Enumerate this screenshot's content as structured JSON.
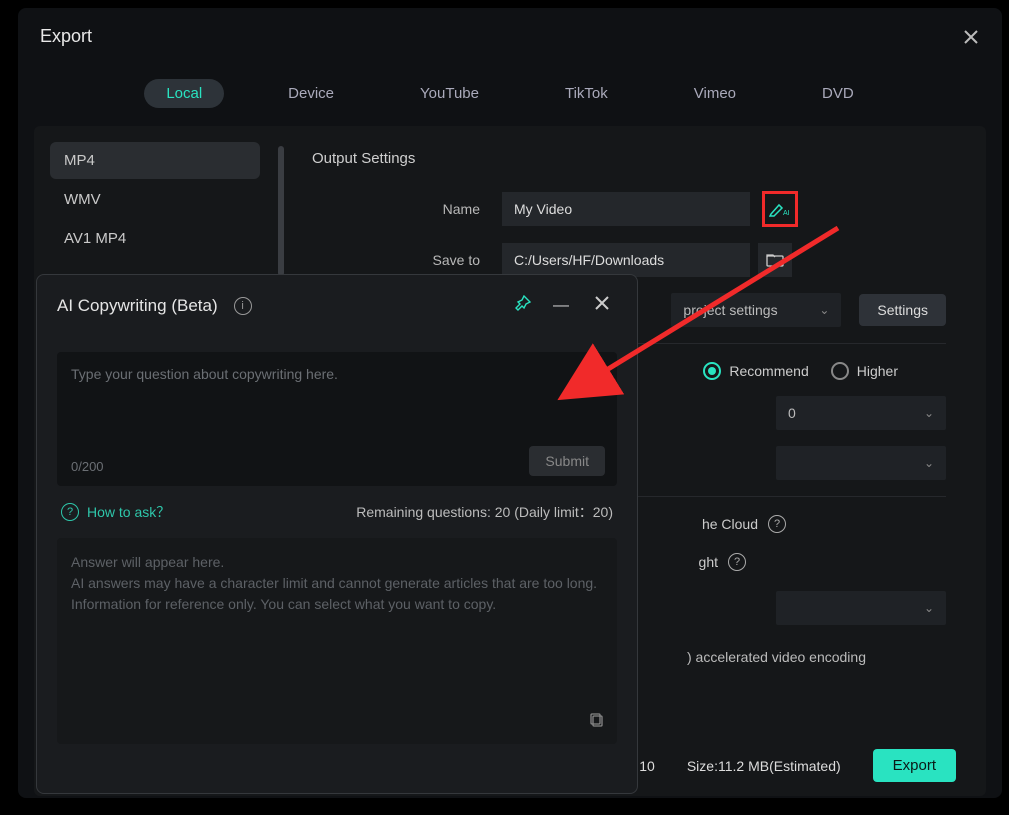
{
  "modal": {
    "title": "Export"
  },
  "tabs": [
    "Local",
    "Device",
    "YouTube",
    "TikTok",
    "Vimeo",
    "DVD"
  ],
  "active_tab": "Local",
  "formats": [
    "MP4",
    "WMV",
    "AV1 MP4"
  ],
  "active_format": "MP4",
  "settings": {
    "section_title": "Output Settings",
    "name_label": "Name",
    "name_value": "My Video",
    "saveto_label": "Save to",
    "saveto_value": "C:/Users/HF/Downloads",
    "preset_partial": "project settings",
    "settings_btn": "Settings",
    "quality": {
      "recommend": "Recommend",
      "higher": "Higher"
    },
    "dropdown_val": "0",
    "cloud_partial": "he Cloud",
    "spot_partial": "ght",
    "gpu_partial": ") accelerated video encoding"
  },
  "footer": {
    "val10": "10",
    "size": "Size:11.2 MB(Estimated)",
    "export_btn": "Export"
  },
  "ai": {
    "title": "AI Copywriting (Beta)",
    "placeholder": "Type your question about copywriting here.",
    "char_count": "0/200",
    "submit": "Submit",
    "how_to_ask": "How to ask？",
    "remaining": "Remaining questions: 20 (Daily limit：20)",
    "answer_line1": "Answer will appear here.",
    "answer_line2": "AI answers may have a character limit and cannot generate articles that are too long.",
    "answer_line3": "Information for reference only. You can select what you want to copy."
  }
}
